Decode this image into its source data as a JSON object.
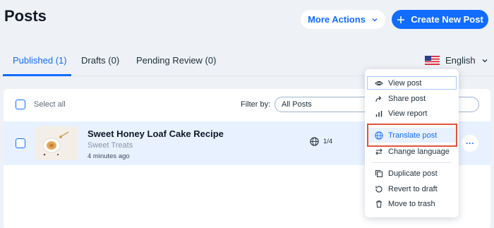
{
  "header": {
    "title": "Posts",
    "more_actions_label": "More Actions",
    "create_label": "Create New Post"
  },
  "tabs": [
    {
      "label": "Published (1)",
      "active": true
    },
    {
      "label": "Drafts (0)",
      "active": false
    },
    {
      "label": "Pending Review (0)",
      "active": false
    }
  ],
  "language": {
    "label": "English",
    "flag": "us-flag-icon"
  },
  "toolbar": {
    "select_all_label": "Select all",
    "filter_label": "Filter by:",
    "filter_value": "All Posts"
  },
  "post": {
    "title": "Sweet Honey Loaf Cake Recipe",
    "category": "Sweet Treats",
    "time": "4 minutes ago",
    "languages": "1/4",
    "more_icon": "ellipsis-icon"
  },
  "menu": {
    "items": [
      {
        "label": "View post",
        "icon": "eye-icon"
      },
      {
        "label": "Share post",
        "icon": "share-icon"
      },
      {
        "label": "View report",
        "icon": "bar-chart-icon"
      },
      {
        "label": "Translate post",
        "icon": "globe-icon"
      },
      {
        "label": "Change language",
        "icon": "swap-icon"
      },
      {
        "label": "Duplicate post",
        "icon": "duplicate-icon"
      },
      {
        "label": "Revert to draft",
        "icon": "revert-icon"
      },
      {
        "label": "Move to trash",
        "icon": "trash-icon"
      }
    ]
  },
  "colors": {
    "accent": "#116dff",
    "highlight_border": "#e0533a",
    "row_selected": "#e8f1ff",
    "background": "#eef1f6"
  }
}
